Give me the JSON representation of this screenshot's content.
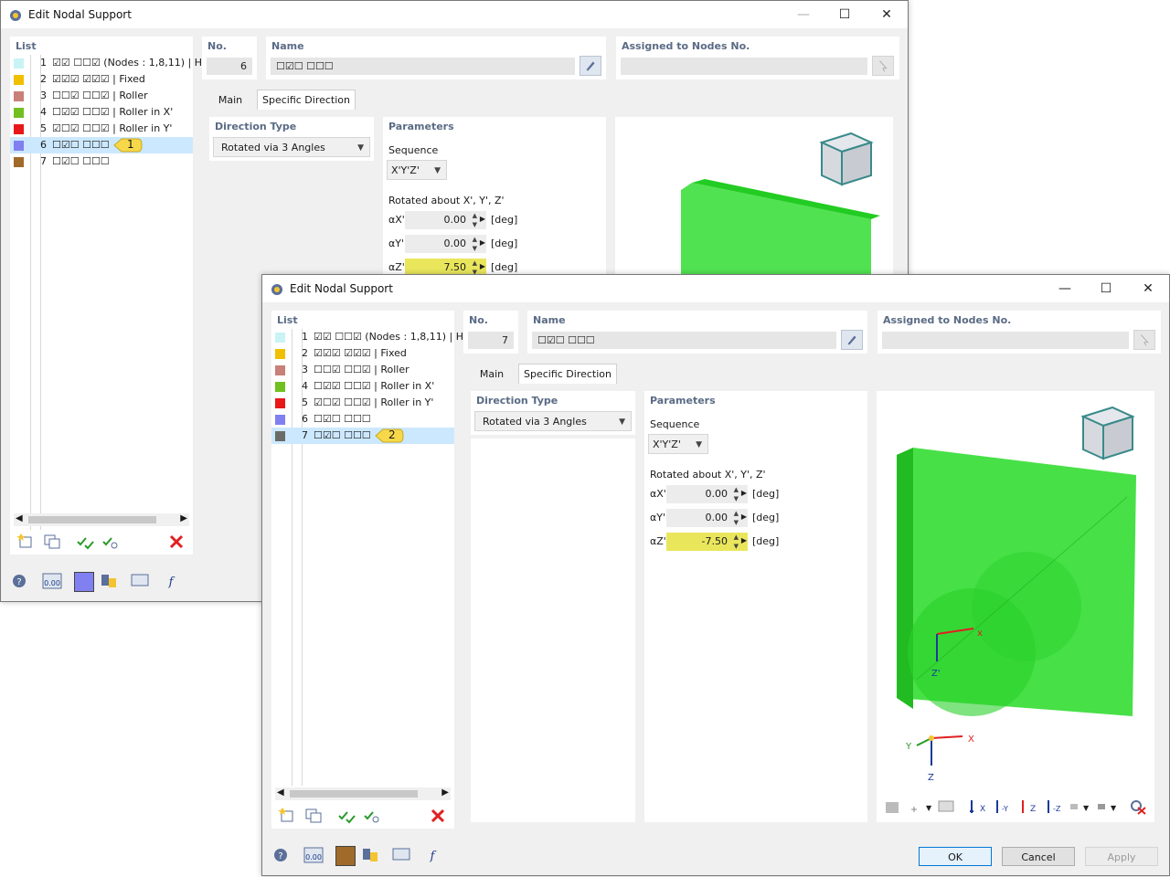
{
  "back": {
    "title": "Edit Nodal Support",
    "list": {
      "label": "List",
      "items": [
        {
          "num": "1",
          "text": "☑☑ ☐☐☑ (Nodes : 1,8,11) | H",
          "color": "#c8f4f6"
        },
        {
          "num": "2",
          "text": "☑☑☑ ☑☑☑ | Fixed",
          "color": "#f0c000"
        },
        {
          "num": "3",
          "text": "☐☐☑ ☐☐☑ | Roller",
          "color": "#c88078"
        },
        {
          "num": "4",
          "text": "☐☑☑ ☐☐☑ | Roller in X'",
          "color": "#70c020"
        },
        {
          "num": "5",
          "text": "☑☐☑ ☐☐☑ | Roller in Y'",
          "color": "#e81818"
        },
        {
          "num": "6",
          "text": "☐☑☐ ☐☐☐",
          "color": "#8080f0"
        },
        {
          "num": "7",
          "text": "☐☑☐ ☐☐☐",
          "color": "#a06a2a"
        }
      ]
    },
    "no": {
      "label": "No.",
      "value": "6"
    },
    "name": {
      "label": "Name",
      "value": "☐☑☐ ☐☐☐"
    },
    "assigned": {
      "label": "Assigned to Nodes No.",
      "value": ""
    },
    "tabs": [
      "Main",
      "Specific Direction"
    ],
    "direction_type": {
      "label": "Direction Type",
      "value": "Rotated via 3 Angles"
    },
    "params": {
      "label": "Parameters",
      "sequence_label": "Sequence",
      "sequence_value": "X'Y'Z'",
      "rotated_label": "Rotated about X', Y', Z'",
      "rows": [
        {
          "sym": "αX'",
          "value": "0.00",
          "unit": "[deg]"
        },
        {
          "sym": "αY'",
          "value": "0.00",
          "unit": "[deg]"
        },
        {
          "sym": "αZ'",
          "value": "7.50",
          "unit": "[deg]"
        }
      ]
    },
    "callout": "1",
    "selected_swatch": "#8080f0"
  },
  "front": {
    "title": "Edit Nodal Support",
    "list": {
      "label": "List",
      "items": [
        {
          "num": "1",
          "text": "☑☑ ☐☐☑ (Nodes : 1,8,11) | H",
          "color": "#c8f4f6"
        },
        {
          "num": "2",
          "text": "☑☑☑ ☑☑☑ | Fixed",
          "color": "#f0c000"
        },
        {
          "num": "3",
          "text": "☐☐☑ ☐☐☑ | Roller",
          "color": "#c88078"
        },
        {
          "num": "4",
          "text": "☐☑☑ ☐☐☑ | Roller in X'",
          "color": "#70c020"
        },
        {
          "num": "5",
          "text": "☑☐☑ ☐☐☑ | Roller in Y'",
          "color": "#e81818"
        },
        {
          "num": "6",
          "text": "☐☑☐ ☐☐☐",
          "color": "#8080f0"
        },
        {
          "num": "7",
          "text": "☐☑☐ ☐☐☐",
          "color": "#6a6a6a"
        }
      ]
    },
    "no": {
      "label": "No.",
      "value": "7"
    },
    "name": {
      "label": "Name",
      "value": "☐☑☐ ☐☐☐"
    },
    "assigned": {
      "label": "Assigned to Nodes No.",
      "value": ""
    },
    "tabs": [
      "Main",
      "Specific Direction"
    ],
    "direction_type": {
      "label": "Direction Type",
      "value": "Rotated via 3 Angles"
    },
    "params": {
      "label": "Parameters",
      "sequence_label": "Sequence",
      "sequence_value": "X'Y'Z'",
      "rotated_label": "Rotated about X', Y', Z'",
      "rows": [
        {
          "sym": "αX'",
          "value": "0.00",
          "unit": "[deg]"
        },
        {
          "sym": "αY'",
          "value": "0.00",
          "unit": "[deg]"
        },
        {
          "sym": "αZ'",
          "value": "-7.50",
          "unit": "[deg]"
        }
      ]
    },
    "callout": "2",
    "selected_swatch": "#a06a2a",
    "axes": {
      "x": "X",
      "y": "Y",
      "z": "Z",
      "local_x": "x",
      "local_z": "Z'"
    },
    "buttons": {
      "ok": "OK",
      "cancel": "Cancel",
      "apply": "Apply"
    },
    "zero_icon": "0.00"
  }
}
